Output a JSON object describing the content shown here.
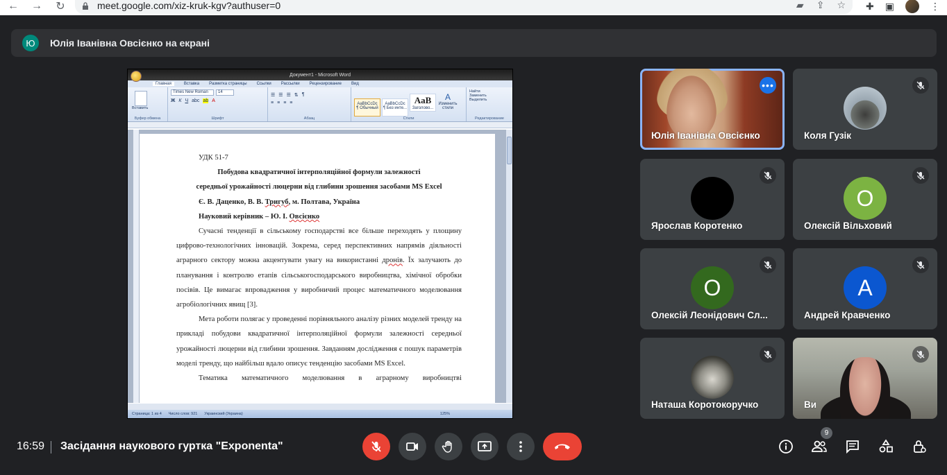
{
  "browser": {
    "url": "meet.google.com/xiz-kruk-kgv?authuser=0"
  },
  "banner": {
    "badge_letter": "Ю",
    "text": "Юлія Іванівна Овсієнко на екрані"
  },
  "word": {
    "window_title": "Документ1 - Microsoft Word",
    "tabs": [
      "Главная",
      "Вставка",
      "Разметка страницы",
      "Ссылки",
      "Рассылки",
      "Рецензирование",
      "Вид"
    ],
    "font_name": "Times New Roman",
    "font_size": "14",
    "groups": [
      "Буфер обмена",
      "Шрифт",
      "Абзац",
      "Стили",
      "Редактирование"
    ],
    "styles": [
      "¶ Обычный",
      "¶ Без инте...",
      "Заголово...",
      "Изменить стили"
    ],
    "style_samples": [
      "AaBbCcDc",
      "AaBbCcDc",
      "AaB"
    ],
    "editing": [
      "Найти",
      "Заменить",
      "Выделить"
    ],
    "paste": "Вставить",
    "status": {
      "page": "Страница: 1 из 4",
      "words": "Число слов: 921",
      "lang": "Украинский (Украина)",
      "zoom": "125%"
    },
    "doc": {
      "udk": "УДК 51-7",
      "title_line1": "Побудова квадратичної інтерполяційної формули залежності",
      "title_line2": "середньої урожайності люцерни від глибини зрошення засобами MS Excel",
      "authors_pre": "Є. В. Даценко, В. В. ",
      "authors_squig": "Тригуб",
      "authors_post": ", м. Полтава, Україна",
      "supervisor_pre": "Науковий керівник – Ю. І. ",
      "supervisor_squig": "Овсієнко",
      "p1_a": "Сучасні тенденції в сільському господарстві все більше переходять у площину цифрово-технологічних інновацій. Зокрема, серед перспективних напрямів діяльності аграрного сектору можна акцентувати увагу на використанні ",
      "p1_squig": "дронів",
      "p1_b": ". Їх залучають до планування і контролю етапів сільськогосподарського виробництва, хімічної обробки посівів. Це вимагає впровадження у виробничий процес математичного моделювання агробіологічних явищ [3].",
      "p2": "Мета роботи полягає у проведенні порівняльного аналізу різних моделей тренду на прикладі побудови квадратичної інтерполяційної формули залежності середньої урожайності люцерни від глибини зрошення. Завданням дослідження є пошук параметрів моделі тренду, що найбільш вдало описує тенденцію засобами MS Excel.",
      "p3": "Тематика математичного моделювання в аграрному виробництві"
    }
  },
  "participants": [
    {
      "name": "Юлія Іванівна Овсієнко",
      "type": "video1",
      "active": true
    },
    {
      "name": "Коля Гузік",
      "type": "car",
      "muted": true
    },
    {
      "name": "Ярослав Коротенко",
      "type": "avatar",
      "color": "#000000",
      "letter": "",
      "muted": true
    },
    {
      "name": "Олексій Вільховий",
      "type": "avatar",
      "color": "#7cb342",
      "letter": "О",
      "muted": true
    },
    {
      "name": "Олексій Леонідович Сл...",
      "type": "avatar",
      "color": "#33691e",
      "letter": "О",
      "muted": true
    },
    {
      "name": "Андрей Кравченко",
      "type": "avatar",
      "color": "#0b57d0",
      "letter": "А",
      "muted": true
    },
    {
      "name": "Наташа Коротокоручко",
      "type": "baby",
      "muted": true
    },
    {
      "name": "Ви",
      "type": "video2",
      "muted": true
    }
  ],
  "meeting": {
    "time": "16:59",
    "title": "Засідання наукового гуртка \"Exponenta\"",
    "people_count": "9"
  },
  "colors": {
    "bg": "#202124",
    "tile": "#3c4043",
    "danger": "#ea4335",
    "accent": "#8ab4f8"
  }
}
